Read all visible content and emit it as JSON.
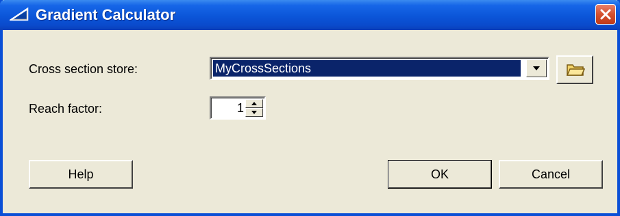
{
  "window": {
    "title": "Gradient Calculator",
    "icon": "gradient-triangle-icon",
    "close_icon": "close-icon"
  },
  "fields": {
    "store": {
      "label": "Cross section store:",
      "value": "MyCrossSections",
      "browse_icon": "folder-icon"
    },
    "reach": {
      "label": "Reach factor:",
      "value": "1"
    }
  },
  "buttons": {
    "help": "Help",
    "ok": "OK",
    "cancel": "Cancel"
  },
  "colors": {
    "titlebar": "#0a4fd6",
    "dialog_bg": "#ece9d8",
    "selection": "#0a246a",
    "close": "#d4502e"
  }
}
